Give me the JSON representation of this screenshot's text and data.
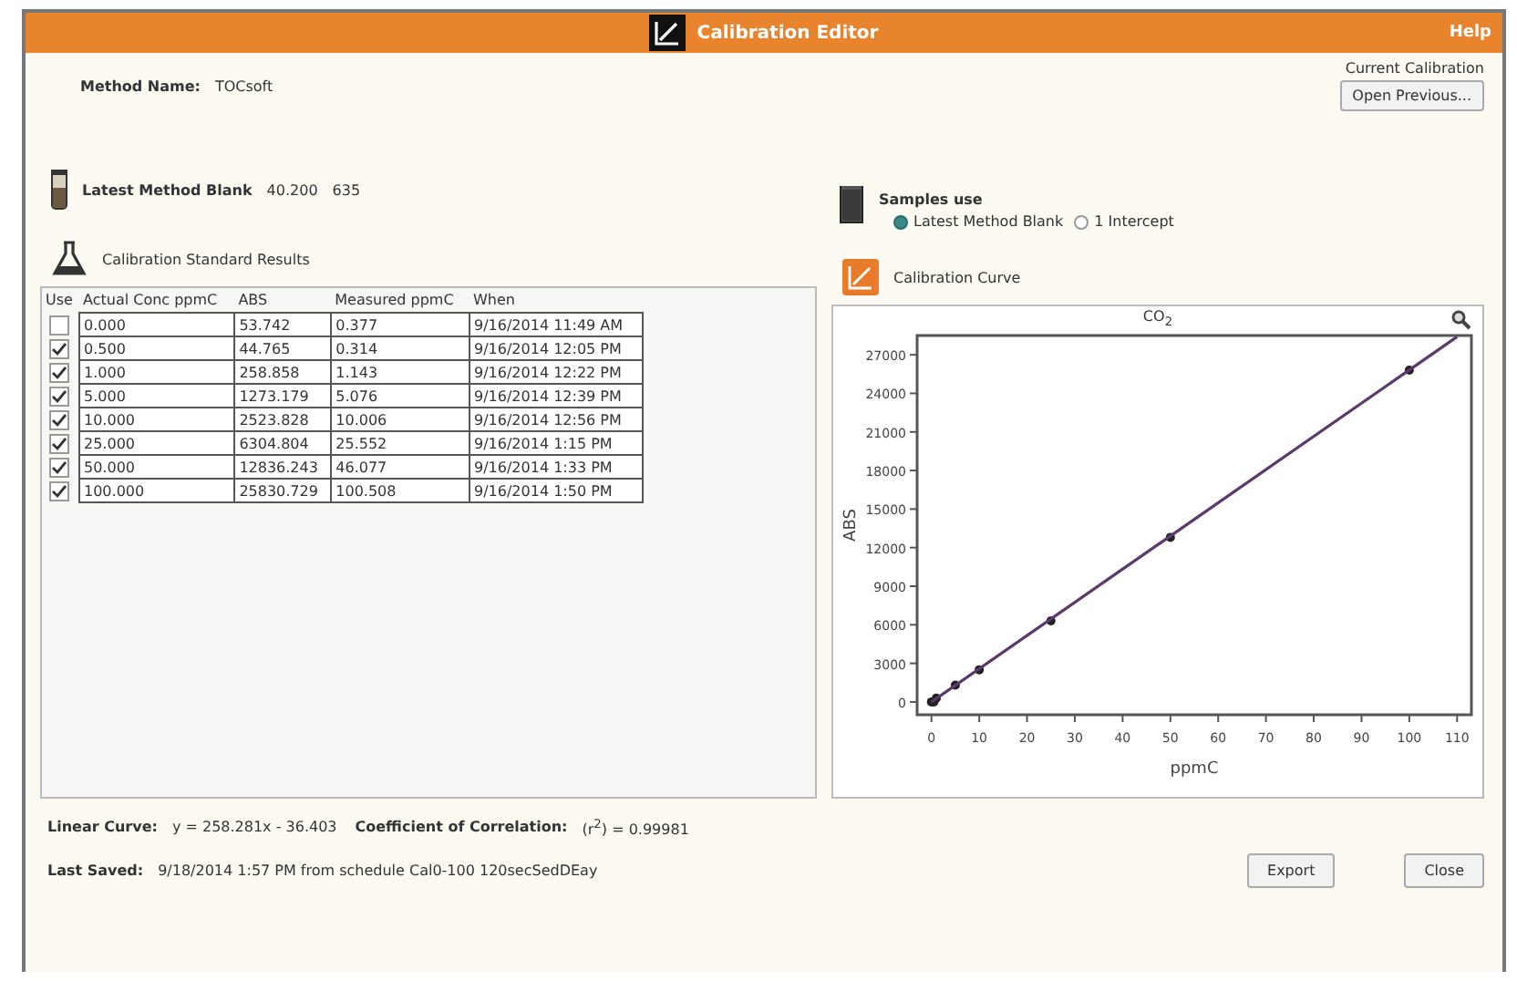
{
  "window": {
    "title": "Calibration Editor",
    "help": "Help"
  },
  "method": {
    "label": "Method Name:",
    "value": "TOCsoft"
  },
  "current_calibration": {
    "label": "Current Calibration",
    "button": "Open Previous..."
  },
  "method_blank": {
    "label": "Latest Method Blank",
    "value_1": "40.200",
    "value_2": "635"
  },
  "samples_use": {
    "title": "Samples use",
    "options": [
      {
        "label": "Latest Method Blank",
        "selected": true
      },
      {
        "label": "1 Intercept",
        "selected": false
      }
    ]
  },
  "standards": {
    "title": "Calibration Standard Results",
    "use_header": "Use",
    "columns": [
      "Actual Conc ppmC",
      "ABS",
      "Measured ppmC",
      "When"
    ],
    "rows": [
      {
        "checked": false,
        "cells": [
          "0.000",
          "53.742",
          "0.377",
          "9/16/2014  11:49 AM"
        ]
      },
      {
        "checked": true,
        "cells": [
          "0.500",
          "44.765",
          "0.314",
          "9/16/2014  12:05 PM"
        ]
      },
      {
        "checked": true,
        "cells": [
          "1.000",
          "258.858",
          "1.143",
          "9/16/2014  12:22 PM"
        ]
      },
      {
        "checked": true,
        "cells": [
          "5.000",
          "1273.179",
          "5.076",
          "9/16/2014  12:39 PM"
        ]
      },
      {
        "checked": true,
        "cells": [
          "10.000",
          "2523.828",
          "10.006",
          "9/16/2014  12:56 PM"
        ]
      },
      {
        "checked": true,
        "cells": [
          "25.000",
          "6304.804",
          "25.552",
          "9/16/2014  1:15 PM"
        ]
      },
      {
        "checked": true,
        "cells": [
          "50.000",
          "12836.243",
          "46.077",
          "9/16/2014  1:33 PM"
        ]
      },
      {
        "checked": true,
        "cells": [
          "100.000",
          "25830.729",
          "100.508",
          "9/16/2014  1:50 PM"
        ]
      }
    ]
  },
  "curve": {
    "title": "Calibration Curve",
    "chart_data": {
      "type": "scatter",
      "title": "CO$_{2}$",
      "xlabel": "ppmC",
      "ylabel": "ABS",
      "xlim": [
        -3,
        113
      ],
      "ylim": [
        -1000,
        28500
      ],
      "xticks": [
        0,
        10,
        20,
        30,
        40,
        50,
        60,
        70,
        80,
        90,
        100,
        110
      ],
      "yticks": [
        0,
        3000,
        6000,
        9000,
        12000,
        15000,
        18000,
        21000,
        24000,
        27000
      ],
      "series": [
        {
          "color": "#222222",
          "x": [
            0,
            0.5,
            1,
            5,
            10,
            25,
            50,
            100
          ],
          "values": [
            0,
            0,
            300,
            1300,
            2500,
            6300,
            12800,
            25800
          ]
        },
        {
          "type": "line",
          "color": "#5a3a6a",
          "x": [
            0,
            110
          ],
          "values": [
            0,
            28400
          ]
        }
      ]
    }
  },
  "linear_curve": {
    "label": "Linear Curve:",
    "value": "y = 258.281x - 36.403"
  },
  "correlation": {
    "label": "Coefficient of Correlation:",
    "value": "(r$^{2}$) =  0.99981"
  },
  "last_saved": {
    "label": "Last Saved:",
    "value": "9/18/2014 1:57 PM from schedule Cal0-100 120secSedDEay"
  },
  "buttons": [
    "Export",
    "Close"
  ]
}
